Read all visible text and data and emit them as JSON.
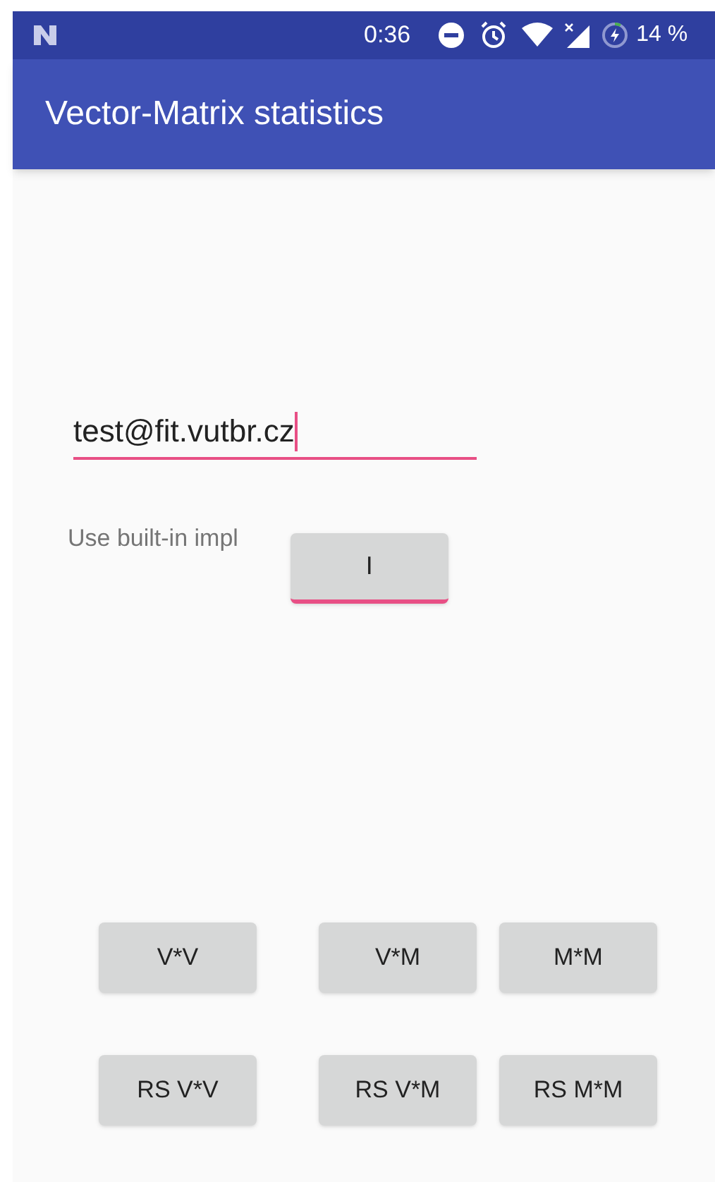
{
  "status_bar": {
    "time": "0:36",
    "battery": "14 %"
  },
  "app_bar": {
    "title": "Vector-Matrix statistics"
  },
  "email_field": {
    "value": "test@fit.vutbr.cz",
    "focused": true
  },
  "impl_label": "Use built-in impl",
  "impl_toggle": {
    "label": "I",
    "checked": true
  },
  "button_rows": [
    [
      "V*V",
      "V*M",
      "M*M"
    ],
    [
      "RS V*V",
      "RS V*M",
      "RS M*M"
    ]
  ]
}
